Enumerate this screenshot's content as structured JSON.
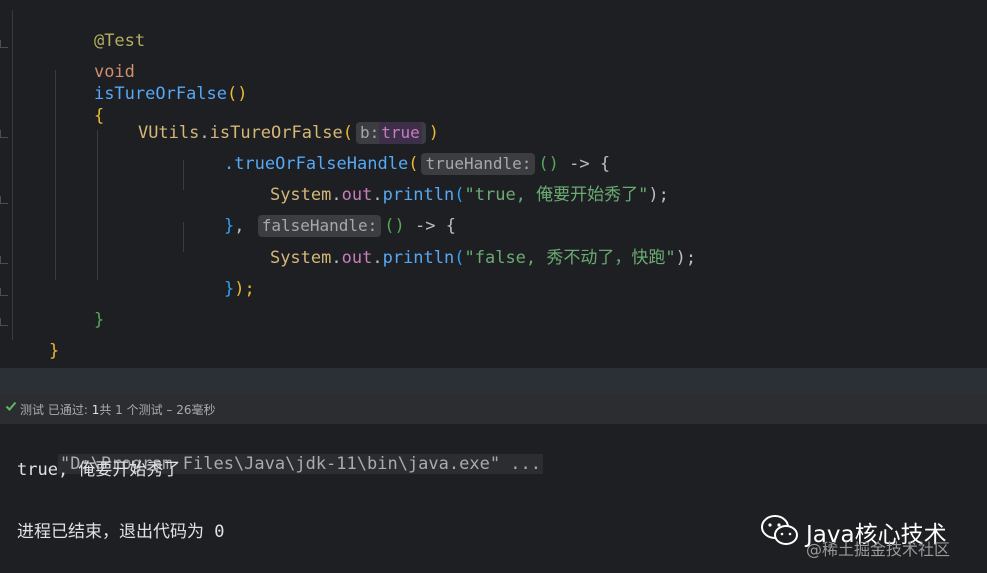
{
  "editor": {
    "lines": {
      "annotation": "@Test",
      "method_kw": "void",
      "method_name": "isTureOrFalse",
      "method_parens": "()",
      "method_open_brace": "{",
      "call_class": "VUtils",
      "call_dot": ".",
      "call_method": "isTureOrFalse",
      "call_open": "(",
      "hint_b": "b:",
      "hint_b_value": "true",
      "call_close": ")",
      "chain_method": ".trueOrFalseHandle",
      "chain_open": "(",
      "hint_true_handle": "trueHandle:",
      "lambda1": "()",
      "arrow1": " -> ",
      "lambda1_brace": "{",
      "print1_class": "System",
      "print1_dot1": ".",
      "print1_field": "out",
      "print1_dot2": ".",
      "print1_method": "println",
      "print1_open": "(",
      "print1_string": "\"true, 俺要开始秀了\"",
      "print1_close": ");",
      "close1_brace": "}",
      "close1_comma": ", ",
      "hint_false_handle": "falseHandle:",
      "lambda2": "()",
      "arrow2": " -> ",
      "lambda2_brace": "{",
      "print2_class": "System",
      "print2_dot1": ".",
      "print2_field": "out",
      "print2_dot2": ".",
      "print2_method": "println",
      "print2_open": "(",
      "print2_string": "\"false, 秀不动了，快跑\"",
      "print2_close": ");",
      "close2_brace": "}",
      "close2_paren": ");",
      "method_close_brace": "}",
      "class_close_brace": "}"
    }
  },
  "status": {
    "icon": "check-icon",
    "label": "测试 已通过:",
    "count": "1",
    "rest": "共 1 个测试 – 26毫秒"
  },
  "console": {
    "command": "\"D:\\Program Files\\Java\\jdk-11\\bin\\java.exe\" ...",
    "output": "true, 俺要开始秀了",
    "exit_message": "进程已结束，退出代码为 0"
  },
  "watermark": {
    "icon": "wechat-icon",
    "title": "Java核心技术",
    "subtitle": "@稀土掘金技术社区"
  },
  "colors": {
    "background": "#1e1f22",
    "keyword": "#cf8e6d",
    "function": "#56a8f5",
    "string": "#6aab73",
    "field": "#c77dbb",
    "annotation": "#b3ae60"
  }
}
